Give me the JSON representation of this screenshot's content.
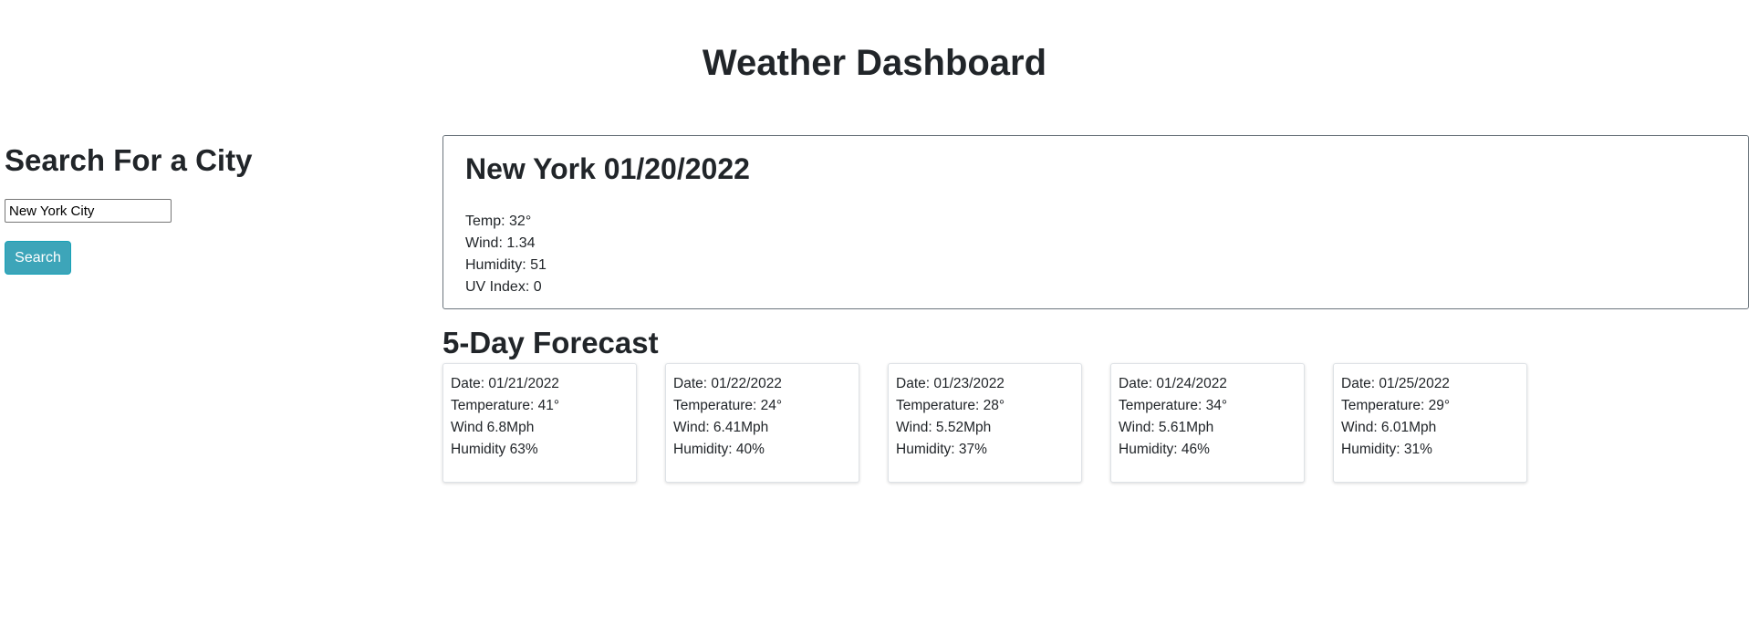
{
  "page": {
    "title": "Weather Dashboard"
  },
  "sidebar": {
    "heading": "Search For a City",
    "search_value": "New York City",
    "search_button_label": "Search"
  },
  "current": {
    "title": "New York 01/20/2022",
    "temp": "Temp: 32°",
    "wind": "Wind: 1.34",
    "humidity": "Humidity: 51",
    "uv_index": "UV Index: 0"
  },
  "forecast": {
    "heading": "5-Day Forecast",
    "days": [
      {
        "date": "Date: 01/21/2022",
        "temperature": "Temperature: 41°",
        "wind": "Wind 6.8Mph",
        "humidity": "Humidity 63%"
      },
      {
        "date": "Date: 01/22/2022",
        "temperature": "Temperature: 24°",
        "wind": "Wind: 6.41Mph",
        "humidity": "Humidity: 40%"
      },
      {
        "date": "Date: 01/23/2022",
        "temperature": "Temperature: 28°",
        "wind": "Wind: 5.52Mph",
        "humidity": "Humidity: 37%"
      },
      {
        "date": "Date: 01/24/2022",
        "temperature": "Temperature: 34°",
        "wind": "Wind: 5.61Mph",
        "humidity": "Humidity: 46%"
      },
      {
        "date": "Date: 01/25/2022",
        "temperature": "Temperature: 29°",
        "wind": "Wind: 6.01Mph",
        "humidity": "Humidity: 31%"
      }
    ]
  },
  "colors": {
    "search_button": "#3da5b9",
    "text": "#212529"
  }
}
